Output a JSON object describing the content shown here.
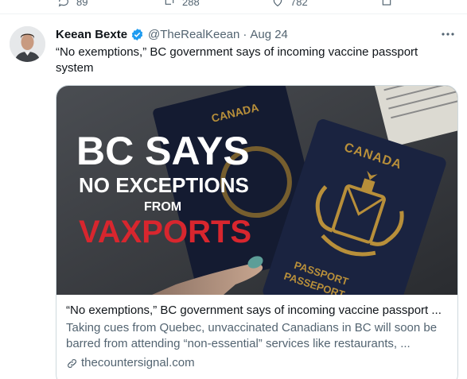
{
  "prev_tweet": {
    "reply_count": "89",
    "retweet_count": "288",
    "like_count": "782"
  },
  "tweet": {
    "author_name": "Keean Bexte",
    "handle": "@TheRealKeean",
    "separator": "·",
    "date": "Aug 24",
    "text": "“No exemptions,” BC government says of incoming vaccine passport system",
    "verified": true
  },
  "card": {
    "image_headline_line1": "BC SAYS",
    "image_headline_line2": "NO EXCEPTIONS",
    "image_headline_line3": "FROM",
    "image_headline_line4": "VAXPORTS",
    "passport_country": "CANADA",
    "passport_label_1": "PASSPORT",
    "passport_label_2": "PASSEPORT",
    "title": "“No exemptions,” BC government says of incoming vaccine passport ...",
    "description": "Taking cues from Quebec, unvaccinated Canadians in BC will soon be barred from attending “non-essential” services like restaurants, ...",
    "domain": "thecountersignal.com"
  },
  "colors": {
    "text_primary": "#0f1419",
    "text_secondary": "#536471",
    "verified_blue": "#1d9bf0",
    "vaxports_red": "#d8262e",
    "passport_navy": "#1a2340",
    "passport_gold": "#b88f3a"
  }
}
